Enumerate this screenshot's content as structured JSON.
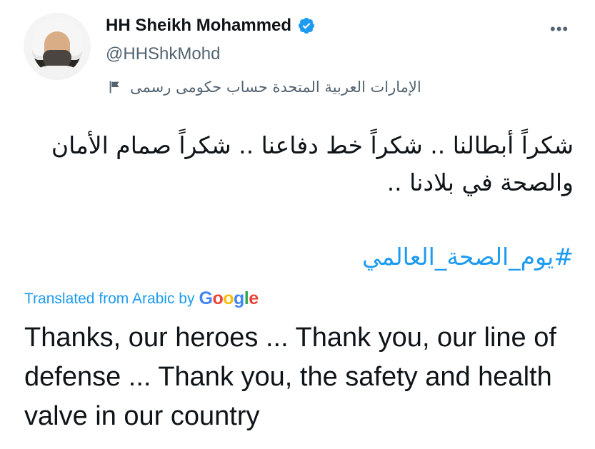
{
  "user": {
    "display_name": "HH Sheikh Mohammed",
    "handle": "@HHShkMohd",
    "account_label": "الإمارات العربية المتحدة حساب حكومى رسمى"
  },
  "icons": {
    "verified": "verified-badge-icon",
    "more": "more-options-icon",
    "flag": "flag-icon"
  },
  "more_symbol": "•••",
  "tweet": {
    "arabic_text": "شكراً أبطالنا .. شكراً خط دفاعنا .. شكراً صمام الأمان والصحة في بلادنا ..",
    "hashtag": "#يوم_الصحة_العالمي",
    "translated_from": "Translated from Arabic by",
    "translator_brand": "Google",
    "translation": "Thanks, our heroes ... Thank you, our line of defense ... Thank you, the safety and health valve in our country"
  },
  "colors": {
    "accent": "#1d9bf0",
    "secondary_text": "#536471",
    "primary_text": "#0f1419"
  }
}
